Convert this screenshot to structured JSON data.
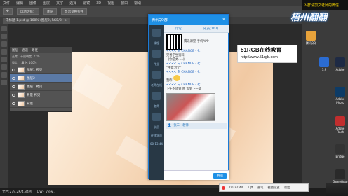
{
  "photoshop": {
    "menu": [
      "文件",
      "编辑",
      "图像",
      "图层",
      "文字",
      "选择",
      "滤镜",
      "3D",
      "视图",
      "窗口",
      "帮助"
    ],
    "options": [
      "自动选择：",
      "图层",
      "显示变换控件"
    ],
    "doc_tab": "未标题-1.psd @ 100% (图层2, RGB/8)",
    "layers_panel": {
      "tabs": [
        "图层",
        "通道",
        "路径"
      ],
      "kind": "正常",
      "opacity_label": "不透明度: 72%",
      "lock_label": "锁定:",
      "fill_label": "填充: 100%",
      "rows": [
        {
          "name": "图层1 拷贝",
          "selected": false
        },
        {
          "name": "图层2",
          "selected": true
        },
        {
          "name": "图层1 拷贝",
          "selected": false
        },
        {
          "name": "背景 拷贝",
          "selected": false
        },
        {
          "name": "背景",
          "selected": false
        }
      ]
    },
    "status_text": "文档:279.2K/4.84M",
    "dwf_label": "DWF View..."
  },
  "chat": {
    "title": "腾讯QQ群",
    "side_labels": [
      "课程",
      "作业",
      "老师在线",
      "老师",
      "学员",
      "在线学员"
    ],
    "timer": "00:13:44",
    "tabs": [
      "讨论",
      "成员(107)"
    ],
    "promo": "腾讯课堂-手机APP",
    "messages": [
      {
        "link": "<<<< 向 CHANGE - 七",
        "text": "完善学生资料"
      },
      {
        "text": "《你是太.....》"
      },
      {
        "link": "<<<< 向 CHANGE - 七",
        "text": "“中意为个”"
      },
      {
        "link": "<<<< 向 CHANGE - 七",
        "text": "我咋"
      },
      {
        "link": "<<<< 向 CHANGE - 七",
        "text": "下午的放到 哦 加到下一级"
      }
    ],
    "sender": "张三 · 老师",
    "send_label": "发送"
  },
  "sign": {
    "title": "51RGB在线教育",
    "url": "http://www.51rgb.com"
  },
  "banner": "入群请加文老师的微信",
  "watermark": "梧州翻翻",
  "desktop_icons": [
    {
      "label": "腾讯QQ",
      "color": "#e8a33b"
    },
    {
      "label": "3.9",
      "color": "#2b6cd2"
    },
    {
      "label": "Adobe",
      "color": "#1e2a44"
    },
    {
      "label": "Adobe Photo",
      "color": "#0d3b66"
    },
    {
      "label": "Adobe Flash",
      "color": "#c12e2e"
    },
    {
      "label": "Bridge",
      "color": "#333"
    },
    {
      "label": "GameGuard",
      "color": "#2a2a2a"
    }
  ],
  "screen_recorder": {
    "time": "00:22:44",
    "tools": [
      "工具",
      "画笔",
      "截图设置",
      "退出"
    ]
  }
}
